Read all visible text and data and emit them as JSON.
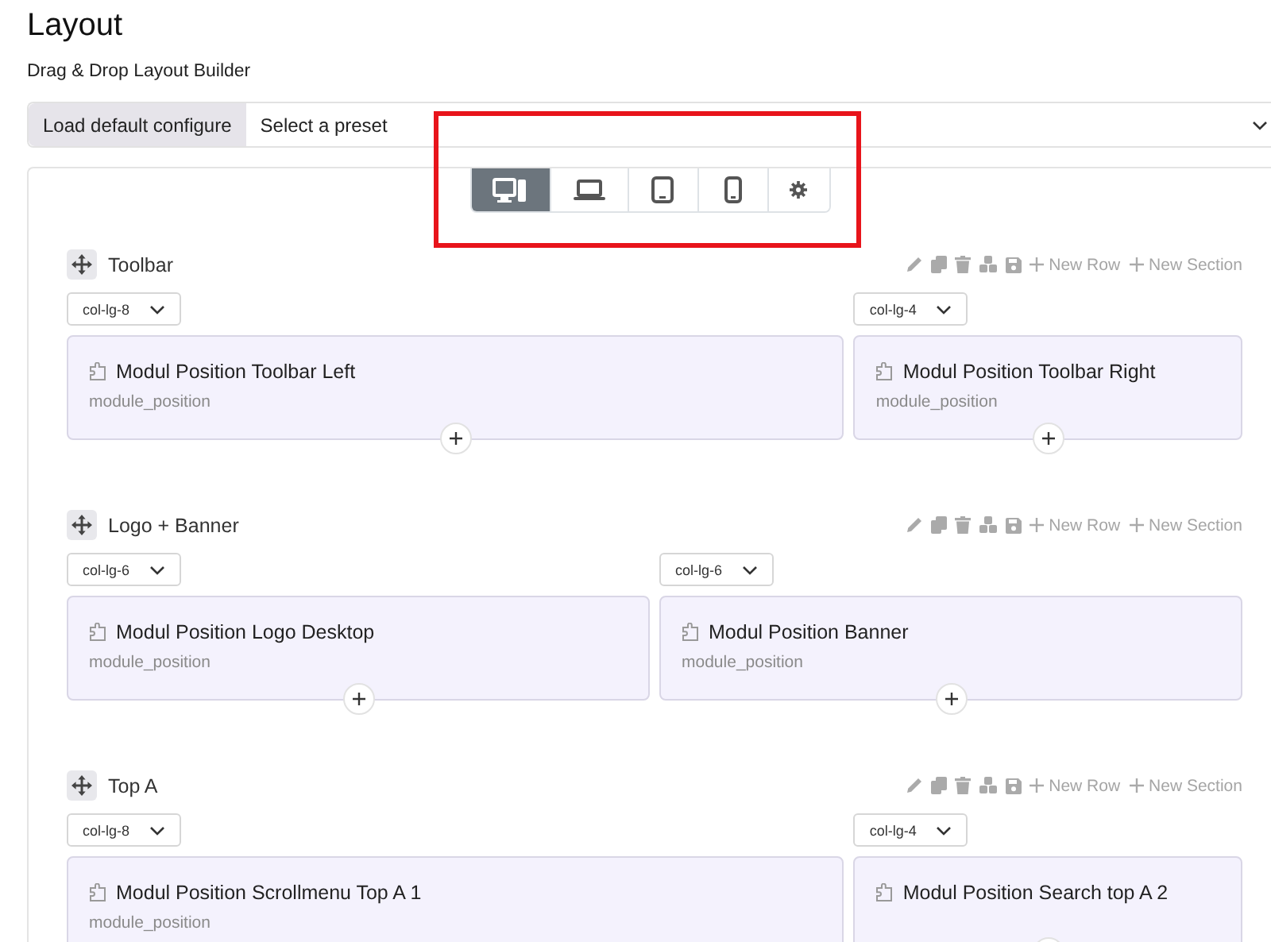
{
  "page": {
    "title": "Layout",
    "subtitle": "Drag & Drop Layout Builder"
  },
  "preset": {
    "button": "Load default configure",
    "placeholder": "Select a preset"
  },
  "devices": [
    {
      "kind": "desktop",
      "selected": true
    },
    {
      "kind": "laptop",
      "selected": false
    },
    {
      "kind": "tablet",
      "selected": false
    },
    {
      "kind": "phone",
      "selected": false
    },
    {
      "kind": "settings",
      "selected": false
    }
  ],
  "sections": [
    {
      "name": "Toolbar",
      "actions": [
        "New Row",
        "New Section"
      ],
      "columns": [
        {
          "size": "col-lg-8",
          "module": "Modul Position Toolbar Left",
          "type": "module_position"
        },
        {
          "size": "col-lg-4",
          "module": "Modul Position Toolbar Right",
          "type": "module_position"
        }
      ]
    },
    {
      "name": "Logo + Banner",
      "actions": [
        "New Row",
        "New Section"
      ],
      "columns": [
        {
          "size": "col-lg-6",
          "module": "Modul Position Logo Desktop",
          "type": "module_position"
        },
        {
          "size": "col-lg-6",
          "module": "Modul Position Banner",
          "type": "module_position"
        }
      ]
    },
    {
      "name": "Top A",
      "actions": [
        "New Row",
        "New Section"
      ],
      "columns": [
        {
          "size": "col-lg-8",
          "module": "Modul Position Scrollmenu Top A 1",
          "type": "module_position"
        },
        {
          "size": "col-lg-4",
          "module": "Modul Position Search top A 2"
        }
      ]
    }
  ]
}
